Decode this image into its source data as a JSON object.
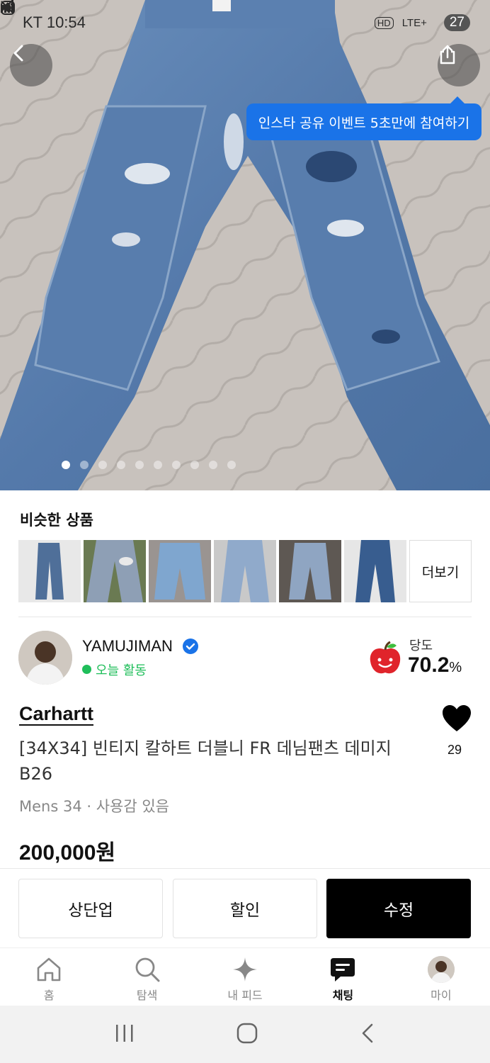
{
  "status_bar": {
    "carrier_time": "KT 10:54",
    "hd": "HD",
    "network": "LTE+",
    "battery": "27"
  },
  "header": {
    "back_icon": "chevron-left-icon",
    "share_icon": "share-icon",
    "share_tooltip": "인스타 공유 이벤트 5초만에 참여하기"
  },
  "gallery": {
    "total_images": 10,
    "current_index": 1
  },
  "similar": {
    "title": "비슷한 상품",
    "more_label": "더보기"
  },
  "seller": {
    "name": "YAMUJIMAN",
    "status": "오늘 활동",
    "sweetness_label": "당도",
    "sweetness_value": "70.2",
    "sweetness_unit": "%"
  },
  "product": {
    "brand": "Carhartt",
    "title": "[34X34] 빈티지 칼하트 더블니 FR 데님팬츠 데미지 B26",
    "meta": "Mens 34 · 사용감 있음",
    "price": "200,000원",
    "likes": "29"
  },
  "actions": {
    "bump": "상단업",
    "discount": "할인",
    "edit": "수정"
  },
  "tabs": [
    {
      "label": "홈",
      "icon": "home-icon"
    },
    {
      "label": "탐색",
      "icon": "search-icon"
    },
    {
      "label": "내 피드",
      "icon": "sparkle-icon"
    },
    {
      "label": "채팅",
      "icon": "chat-icon"
    },
    {
      "label": "마이",
      "icon": "avatar-icon"
    }
  ],
  "colors": {
    "accent_blue": "#1a73e8",
    "active_green": "#1fbe5a",
    "primary_black": "#000000"
  }
}
